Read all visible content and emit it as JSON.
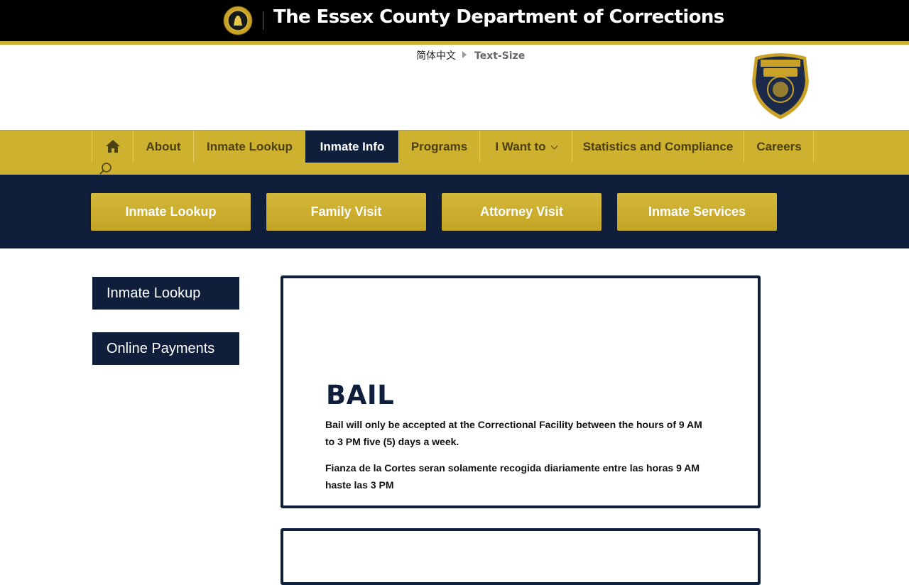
{
  "header": {
    "title": "The Essex County Department of Corrections",
    "language_link": "简体中文",
    "text_size_label": "Text-Size"
  },
  "nav": {
    "home_icon": "home-icon",
    "search_icon": "search-icon",
    "items": [
      {
        "label": "About"
      },
      {
        "label": "Inmate Lookup"
      },
      {
        "label": "Inmate Info",
        "active": true
      },
      {
        "label": "Programs"
      },
      {
        "label": "I Want to",
        "has_dropdown": true
      },
      {
        "label": "Statistics and Compliance"
      },
      {
        "label": "Careers"
      }
    ]
  },
  "quick_links": [
    {
      "label": "Inmate Lookup"
    },
    {
      "label": "Family Visit"
    },
    {
      "label": "Attorney Visit"
    },
    {
      "label": "Inmate Services"
    }
  ],
  "sidebar": {
    "items": [
      {
        "label": "Inmate Lookup"
      },
      {
        "label": "Online Payments"
      }
    ]
  },
  "bail_card": {
    "title": "BAIL",
    "paragraphs": [
      "Bail will only be accepted at the Correctional Facility between the hours of 9 AM to 3 PM five (5) days a week.",
      "Fianza de la Cortes seran solamente recogida diariamente entre las horas 9 AM haste las 3 PM"
    ]
  },
  "colors": {
    "navy": "#0f1f3b",
    "gold": "#cfb130",
    "black": "#000000"
  }
}
